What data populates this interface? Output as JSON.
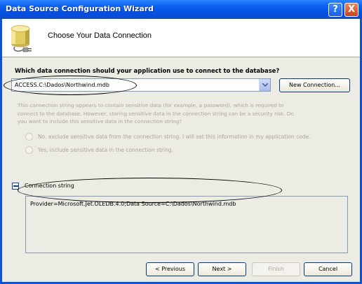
{
  "window": {
    "title": "Data Source Configuration Wizard",
    "help_glyph": "?",
    "close_glyph": "X",
    "colors": {
      "titlebar": "#0a5fec",
      "dialog_bg": "#ecebe4"
    }
  },
  "header": {
    "title": "Choose Your Data Connection",
    "icon": "database-plug-icon"
  },
  "connection": {
    "question": "Which data connection should your application use to connect to the database?",
    "selected": "ACCESS.C:\\Dados\\Northwind.mdb",
    "new_connection_label": "New Connection..."
  },
  "sensitive": {
    "line1": "This connection string appears to contain sensitive data (for example, a password), which is required to",
    "line2": "connect to the database. However, storing sensitive data in the connection string can be a security risk. Do",
    "line3": "you want to include this sensitive data in the connection string?",
    "option_no": "No, exclude sensitive data from the connection string. I will set this information in my application code.",
    "option_yes": "Yes, include sensitive data in the connection string."
  },
  "connection_string": {
    "label": "Connection string",
    "value": "Provider=Microsoft.Jet.OLEDB.4.0;Data Source=C:\\Dados\\Northwind.mdb"
  },
  "footer": {
    "previous": "< Previous",
    "next": "Next >",
    "finish": "Finish",
    "cancel": "Cancel"
  }
}
